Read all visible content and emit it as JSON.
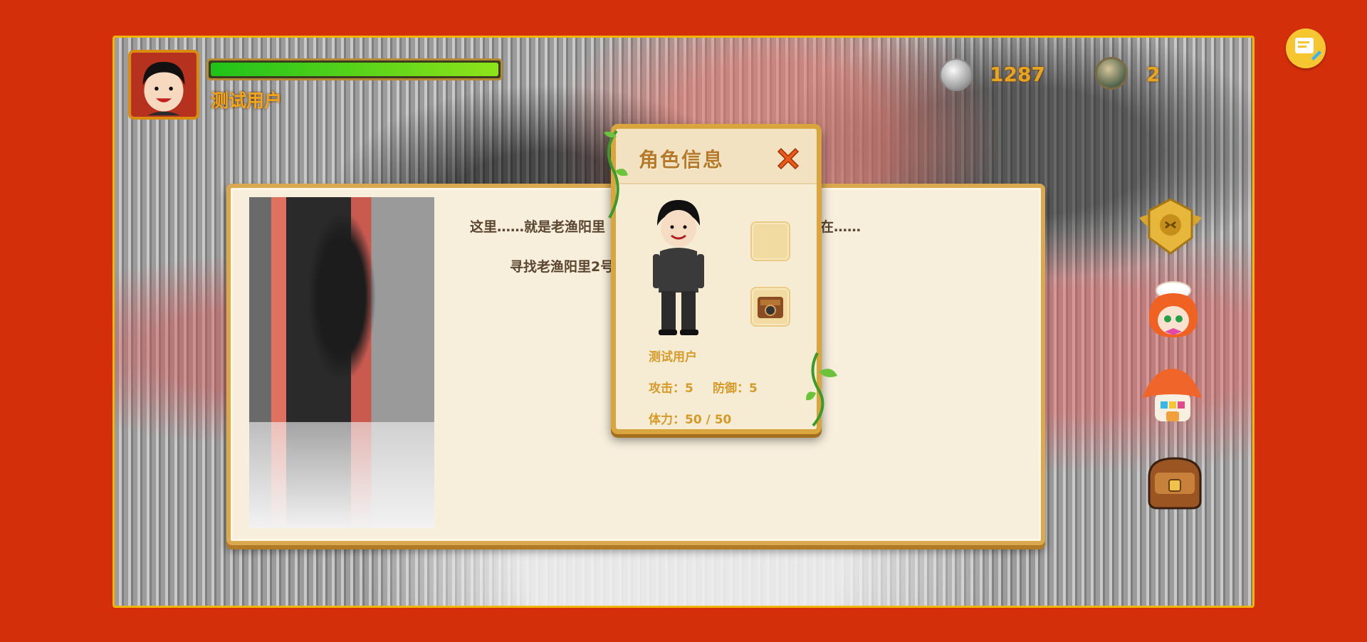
{
  "player": {
    "name": "测试用户",
    "hp_fraction": 1.0
  },
  "currency": {
    "silver": "1287",
    "gold": "2"
  },
  "story": {
    "line1_left": "这里……就是老渔阳里",
    "line1_right": "在……",
    "line2": "寻找老渔阳里2号"
  },
  "character_panel": {
    "title": "角色信息",
    "name": "测试用户",
    "attack": "攻击：5",
    "defense": "防御：5",
    "stamina": "体力：50 / 50"
  },
  "colors": {
    "frame": "#d32f0a",
    "accent": "#f1b400",
    "hp": "#1fc21a"
  },
  "icons": [
    "chat-icon",
    "silver-coin-icon",
    "gold-coin-icon",
    "badge-icon",
    "chef-icon",
    "house-icon",
    "bag-icon",
    "close-icon"
  ]
}
